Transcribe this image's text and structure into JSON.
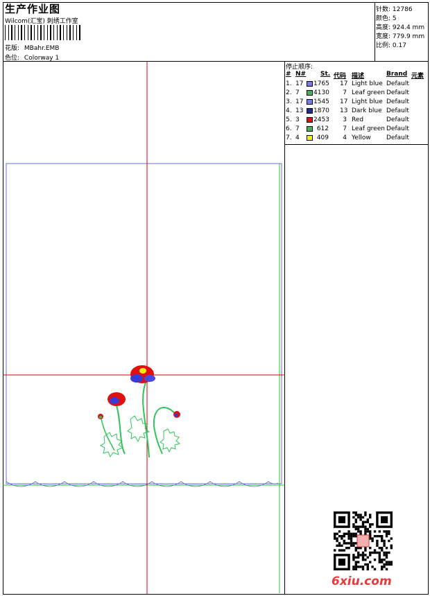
{
  "header": {
    "title": "生产作业图",
    "software": "Wilcom(汇宝) 刺绣工作室",
    "design_label": "花版:",
    "design_value": "MBahr.EMB",
    "colorway_label": "色位:",
    "colorway_value": "Colorway 1"
  },
  "stats": [
    {
      "label": "针数:",
      "value": "12786"
    },
    {
      "label": "颜色:",
      "value": "5"
    },
    {
      "label": "高度:",
      "value": "924.4 mm"
    },
    {
      "label": "宽度:",
      "value": "779.9 mm"
    },
    {
      "label": "比例:",
      "value": "0.17"
    }
  ],
  "stop_sequence": {
    "title": "停止顺序:",
    "headers": {
      "num": "#",
      "n": "N#",
      "st": "St.",
      "code": "代码",
      "desc": "描述",
      "brand": "Brand",
      "element": "元素"
    },
    "rows": [
      {
        "idx": "1.",
        "n": "17",
        "color": "#7a7af0",
        "st": "1765",
        "code": "17",
        "desc": "Light blue",
        "brand": "Default"
      },
      {
        "idx": "2.",
        "n": "7",
        "color": "#3cb85a",
        "st": "4130",
        "code": "7",
        "desc": "Leaf green",
        "brand": "Default"
      },
      {
        "idx": "3.",
        "n": "17",
        "color": "#7a7af0",
        "st": "1545",
        "code": "17",
        "desc": "Light blue",
        "brand": "Default"
      },
      {
        "idx": "4.",
        "n": "13",
        "color": "#1f2f8c",
        "st": "1870",
        "code": "13",
        "desc": "Dark blue",
        "brand": "Default"
      },
      {
        "idx": "5.",
        "n": "3",
        "color": "#e01010",
        "st": "2453",
        "code": "3",
        "desc": "Red",
        "brand": "Default"
      },
      {
        "idx": "6.",
        "n": "7",
        "color": "#3cb85a",
        "st": "612",
        "code": "7",
        "desc": "Leaf green",
        "brand": "Default"
      },
      {
        "idx": "7.",
        "n": "4",
        "color": "#f2f20a",
        "st": "409",
        "code": "4",
        "desc": "Yellow",
        "brand": "Default"
      }
    ]
  },
  "watermark": "6xiu.com"
}
